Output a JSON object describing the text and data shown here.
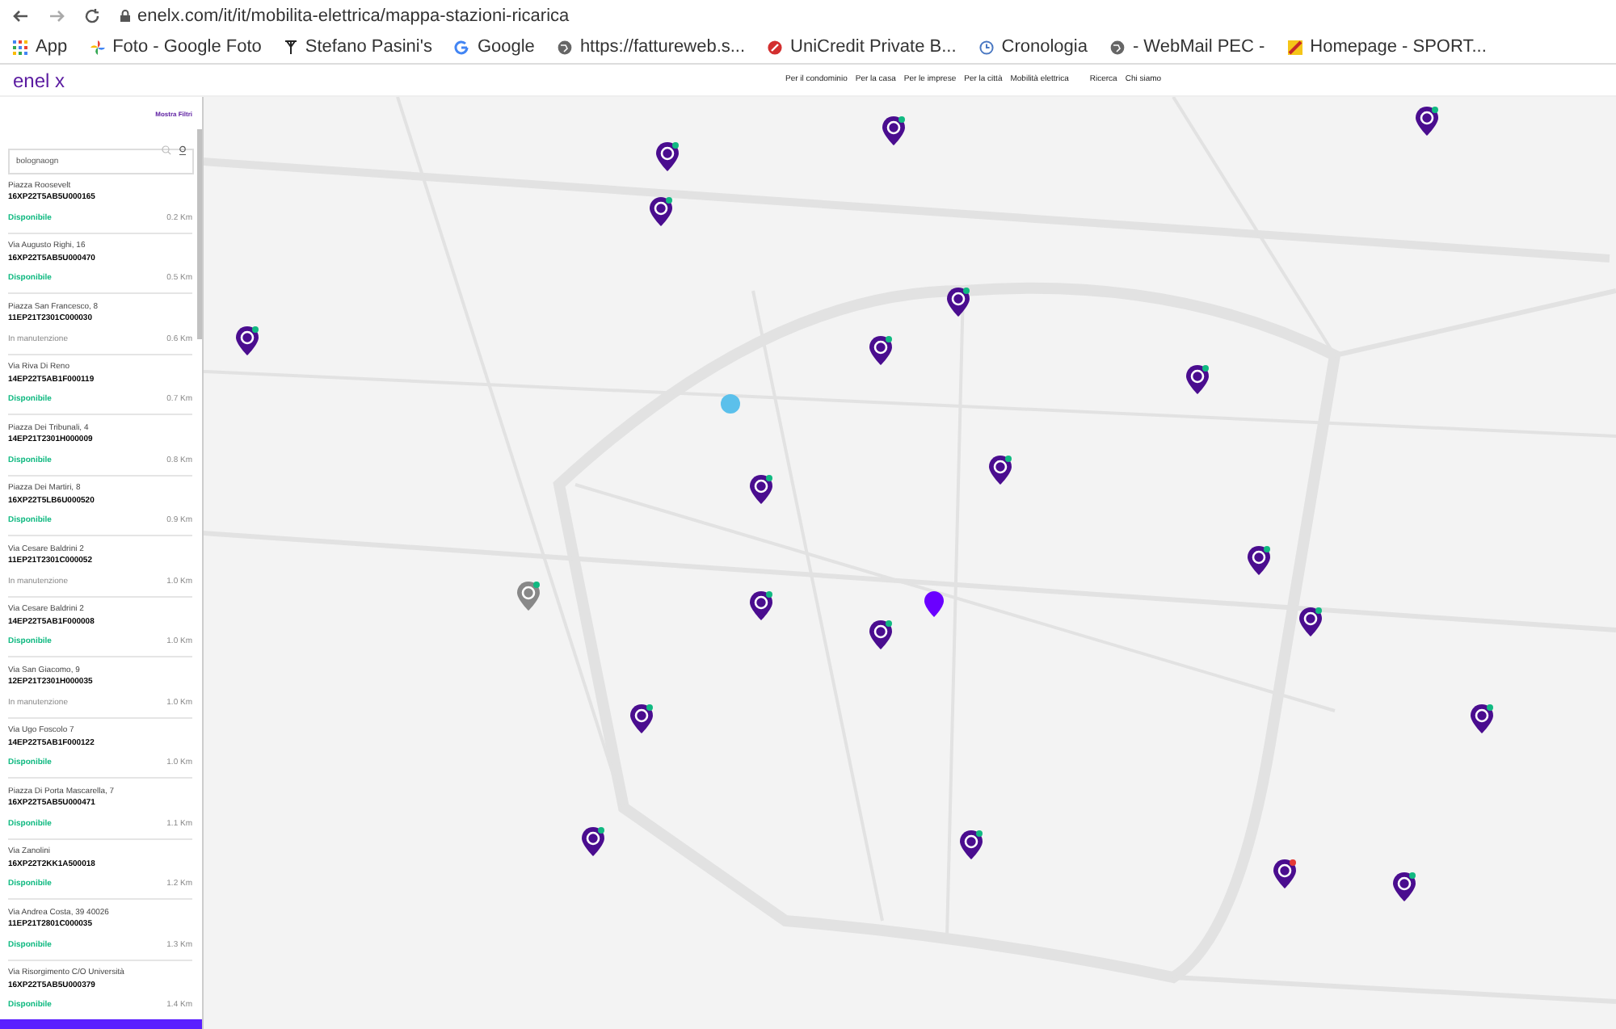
{
  "browser": {
    "url": "enelx.com/it/it/mobilita-elettrica/mappa-stazioni-ricarica",
    "bookmarks": [
      "App",
      "Foto - Google Foto",
      "Stefano Pasini's",
      "Google",
      "https://fattureweb.s...",
      "UniCredit Private B...",
      "Cronologia",
      "- WebMail PEC -",
      "Homepage - SPORT..."
    ]
  },
  "header": {
    "logo": "enel x",
    "nav": [
      "Per il condominio",
      "Per la casa",
      "Per le imprese",
      "Per la città",
      "Mobilità elettrica",
      "Ricerca",
      "Chi siamo"
    ]
  },
  "sidebar": {
    "filters_link": "Mostra Filtri",
    "search": {
      "value": "bolognaogn"
    },
    "stations": [
      {
        "address": "Piazza Roosevelt",
        "code": "16XP22T5AB5U000165",
        "status": "Disponibile",
        "available": true,
        "distance": "0.2 Km"
      },
      {
        "address": "Via Augusto Righi, 16",
        "code": "16XP22T5AB5U000470",
        "status": "Disponibile",
        "available": true,
        "distance": "0.5 Km"
      },
      {
        "address": "Piazza San Francesco, 8",
        "code": "11EP21T2301C000030",
        "status": "In manutenzione",
        "available": false,
        "distance": "0.6 Km"
      },
      {
        "address": "Via Riva Di Reno",
        "code": "14EP22T5AB1F000119",
        "status": "Disponibile",
        "available": true,
        "distance": "0.7 Km"
      },
      {
        "address": "Piazza Dei Tribunali, 4",
        "code": "14EP21T2301H000009",
        "status": "Disponibile",
        "available": true,
        "distance": "0.8 Km"
      },
      {
        "address": "Piazza Dei Martiri, 8",
        "code": "16XP22T5LB6U000520",
        "status": "Disponibile",
        "available": true,
        "distance": "0.9 Km"
      },
      {
        "address": "Via Cesare Baldrini 2",
        "code": "11EP21T2301C000052",
        "status": "In manutenzione",
        "available": false,
        "distance": "1.0 Km"
      },
      {
        "address": "Via Cesare Baldrini 2",
        "code": "14EP22T5AB1F000008",
        "status": "Disponibile",
        "available": true,
        "distance": "1.0 Km"
      },
      {
        "address": "Via San Giacomo, 9",
        "code": "12EP21T2301H000035",
        "status": "In manutenzione",
        "available": false,
        "distance": "1.0 Km"
      },
      {
        "address": "Via Ugo Foscolo 7",
        "code": "14EP22T5AB1F000122",
        "status": "Disponibile",
        "available": true,
        "distance": "1.0 Km"
      },
      {
        "address": "Piazza Di Porta Mascarella, 7",
        "code": "16XP22T5AB5U000471",
        "status": "Disponibile",
        "available": true,
        "distance": "1.1 Km"
      },
      {
        "address": "Via Zanolini",
        "code": "16XP22T2KK1A500018",
        "status": "Disponibile",
        "available": true,
        "distance": "1.2 Km"
      },
      {
        "address": "Via Andrea Costa, 39 40026",
        "code": "11EP21T2801C000035",
        "status": "Disponibile",
        "available": true,
        "distance": "1.3 Km"
      },
      {
        "address": "Via Risorgimento C/O Università",
        "code": "16XP22T5AB5U000379",
        "status": "Disponibile",
        "available": true,
        "distance": "1.4 Km"
      }
    ]
  }
}
